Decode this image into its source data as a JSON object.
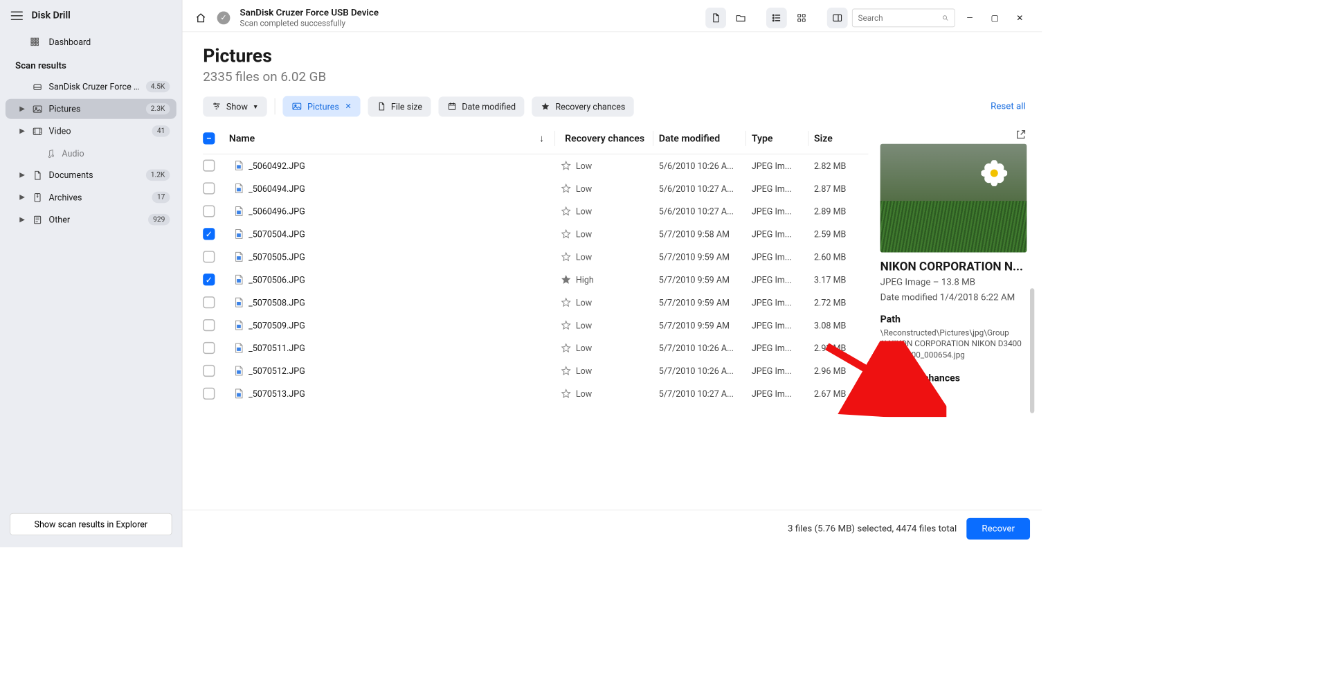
{
  "app": {
    "title": "Disk Drill"
  },
  "sidebar": {
    "dashboard": "Dashboard",
    "scan_results_label": "Scan results",
    "items": [
      {
        "label": "SanDisk Cruzer Force U...",
        "badge": "4.5K"
      },
      {
        "label": "Pictures",
        "badge": "2.3K"
      },
      {
        "label": "Video",
        "badge": "41"
      },
      {
        "label": "Audio",
        "badge": ""
      },
      {
        "label": "Documents",
        "badge": "1.2K"
      },
      {
        "label": "Archives",
        "badge": "17"
      },
      {
        "label": "Other",
        "badge": "929"
      }
    ],
    "explorer_btn": "Show scan results in Explorer"
  },
  "header": {
    "device": "SanDisk Cruzer Force USB Device",
    "status": "Scan completed successfully",
    "search_placeholder": "Search"
  },
  "page": {
    "title": "Pictures",
    "subtitle": "2335 files on 6.02 GB"
  },
  "filters": {
    "show": "Show",
    "pictures": "Pictures",
    "filesize": "File size",
    "datemod": "Date modified",
    "recchance": "Recovery chances",
    "reset": "Reset all"
  },
  "columns": {
    "name": "Name",
    "recovery": "Recovery chances",
    "date": "Date modified",
    "type": "Type",
    "size": "Size"
  },
  "rows": [
    {
      "checked": false,
      "name": "_5060492.JPG",
      "recovery": "Low",
      "high": false,
      "date": "5/6/2010 10:26 A...",
      "type": "JPEG Im...",
      "size": "2.82 MB"
    },
    {
      "checked": false,
      "name": "_5060494.JPG",
      "recovery": "Low",
      "high": false,
      "date": "5/6/2010 10:27 A...",
      "type": "JPEG Im...",
      "size": "2.87 MB"
    },
    {
      "checked": false,
      "name": "_5060496.JPG",
      "recovery": "Low",
      "high": false,
      "date": "5/6/2010 10:27 A...",
      "type": "JPEG Im...",
      "size": "2.89 MB"
    },
    {
      "checked": true,
      "name": "_5070504.JPG",
      "recovery": "Low",
      "high": false,
      "date": "5/7/2010 9:58 AM",
      "type": "JPEG Im...",
      "size": "2.59 MB"
    },
    {
      "checked": false,
      "name": "_5070505.JPG",
      "recovery": "Low",
      "high": false,
      "date": "5/7/2010 9:59 AM",
      "type": "JPEG Im...",
      "size": "2.60 MB"
    },
    {
      "checked": true,
      "name": "_5070506.JPG",
      "recovery": "High",
      "high": true,
      "date": "5/7/2010 9:59 AM",
      "type": "JPEG Im...",
      "size": "3.17 MB"
    },
    {
      "checked": false,
      "name": "_5070508.JPG",
      "recovery": "Low",
      "high": false,
      "date": "5/7/2010 9:59 AM",
      "type": "JPEG Im...",
      "size": "2.72 MB"
    },
    {
      "checked": false,
      "name": "_5070509.JPG",
      "recovery": "Low",
      "high": false,
      "date": "5/7/2010 9:59 AM",
      "type": "JPEG Im...",
      "size": "3.08 MB"
    },
    {
      "checked": false,
      "name": "_5070511.JPG",
      "recovery": "Low",
      "high": false,
      "date": "5/7/2010 10:26 A...",
      "type": "JPEG Im...",
      "size": "2.93 MB"
    },
    {
      "checked": false,
      "name": "_5070512.JPG",
      "recovery": "Low",
      "high": false,
      "date": "5/7/2010 10:26 A...",
      "type": "JPEG Im...",
      "size": "2.96 MB"
    },
    {
      "checked": false,
      "name": "_5070513.JPG",
      "recovery": "Low",
      "high": false,
      "date": "5/7/2010 10:27 A...",
      "type": "JPEG Im...",
      "size": "2.67 MB"
    }
  ],
  "preview": {
    "title": "NIKON CORPORATION N...",
    "sub": "JPEG Image – 13.8 MB",
    "date": "Date modified 1/4/2018 6:22 AM",
    "path_label": "Path",
    "path": "\\Reconstructed\\Pictures\\jpg\\Group 1\\NIKON CORPORATION NIKON D3400 6000_4000_000654.jpg",
    "recovery_label": "Recovery chances"
  },
  "footer": {
    "status": "3 files (5.76 MB) selected, 4474 files total",
    "recover_btn": "Recover"
  }
}
